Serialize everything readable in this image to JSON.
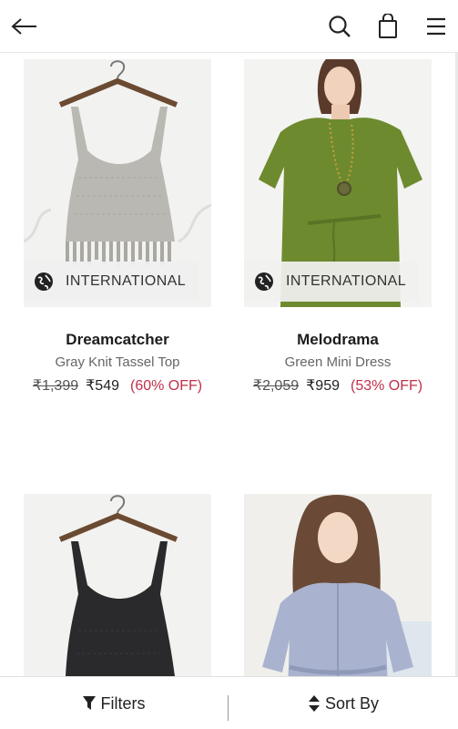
{
  "header": {
    "back_icon": "arrow-left-icon",
    "search_icon": "search-icon",
    "bag_icon": "shopping-bag-icon",
    "menu_icon": "hamburger-menu-icon"
  },
  "products": [
    {
      "badge": "INTERNATIONAL",
      "brand": "Dreamcatcher",
      "name": "Gray Knit Tassel Top",
      "mrp": "₹1,399",
      "price": "₹549",
      "discount": "(60% OFF)"
    },
    {
      "badge": "INTERNATIONAL",
      "brand": "Melodrama",
      "name": "Green Mini Dress",
      "mrp": "₹2,059",
      "price": "₹959",
      "discount": "(53% OFF)"
    }
  ],
  "footer": {
    "filters_label": "Filters",
    "sort_label": "Sort By"
  },
  "colors": {
    "discount": "#c0304a",
    "gray_top": "#b9b8b2",
    "green_dress": "#6e8a2e",
    "black_top": "#2a2a2c",
    "blue_dress": "#a9b3cf"
  }
}
